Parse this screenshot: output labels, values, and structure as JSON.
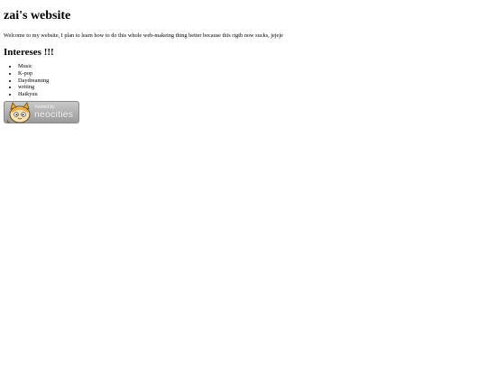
{
  "site": {
    "title": "zai's website",
    "intro": "Welcome to my website, I plan to learn how to do this whole web-makeing thing better because this rigth now sucks, jejeje"
  },
  "interests": {
    "heading": "Intereses !!!",
    "items": [
      "Music",
      "K-pop",
      "Daydreaming",
      "writing",
      "Haikyuu"
    ]
  },
  "badge": {
    "hosted_label": "hosted by",
    "brand": "neocities",
    "icon": "neocities-cat-icon"
  }
}
